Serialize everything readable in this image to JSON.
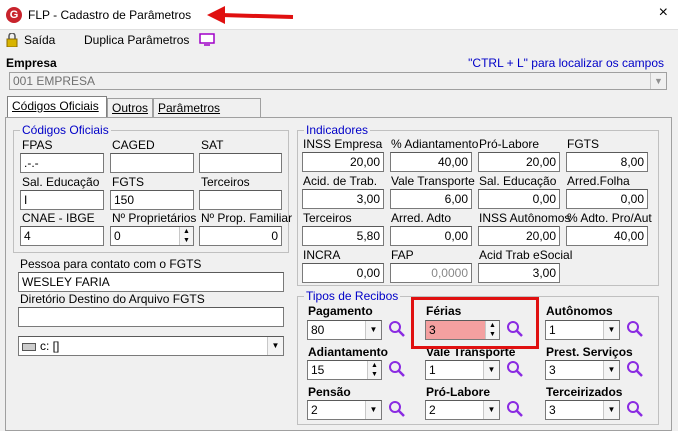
{
  "window": {
    "title": "FLP - Cadastro de Parâmetros",
    "close_symbol": "×",
    "app_icon_letter": "G"
  },
  "toolbar": {
    "exit_label": "Saída",
    "duplicate_label": "Duplica Parâmetros"
  },
  "empresa": {
    "label": "Empresa",
    "hint": "\"CTRL + L\" para localizar os campos",
    "value": "001 EMPRESA"
  },
  "tabs": [
    {
      "label": "Códigos Oficiais",
      "active": true
    },
    {
      "label": "Outros",
      "active": false
    },
    {
      "label": "Parâmetros Internos",
      "active": false
    }
  ],
  "codigos": {
    "legend": "Códigos Oficiais",
    "fpas_label": "FPAS",
    "fpas_value": ".-.-",
    "caged_label": "CAGED",
    "caged_value": "",
    "sat_label": "SAT",
    "sat_value": "",
    "sal_educacao_label": "Sal. Educação",
    "sal_educacao_value": "I",
    "fgts_label": "FGTS",
    "fgts_value": "150",
    "terceiros_label": "Terceiros",
    "terceiros_value": "",
    "cnae_label": "CNAE - IBGE",
    "cnae_value": "4",
    "nproprietarios_label": "Nº Proprietários",
    "nproprietarios_value": "0",
    "npropfamiliar_label": "Nº Prop. Familiar",
    "npropfamiliar_value": "0",
    "contato_label": "Pessoa para contato com o FGTS",
    "contato_value": "WESLEY FARIA",
    "diretorio_label": "Diretório Destino do Arquivo FGTS",
    "diretorio_value": "",
    "drive_value": "c: []"
  },
  "indicadores": {
    "legend": "Indicadores",
    "items": [
      {
        "label": "INSS Empresa",
        "value": "20,00"
      },
      {
        "label": "% Adiantamento",
        "value": "40,00"
      },
      {
        "label": "Pró-Labore",
        "value": "20,00"
      },
      {
        "label": "FGTS",
        "value": "8,00"
      },
      {
        "label": "Acid. de Trab.",
        "value": "3,00"
      },
      {
        "label": "Vale Transporte",
        "value": "6,00"
      },
      {
        "label": "Sal. Educação",
        "value": "0,00"
      },
      {
        "label": "Arred.Folha",
        "value": "0,00"
      },
      {
        "label": "Terceiros",
        "value": "5,80"
      },
      {
        "label": "Arred. Adto",
        "value": "0,00"
      },
      {
        "label": "INSS Autônomos",
        "value": "20,00"
      },
      {
        "label": "% Adto. Pro/Aut",
        "value": "40,00"
      },
      {
        "label": "INCRA",
        "value": "0,00"
      },
      {
        "label": "FAP",
        "value": "0,0000"
      },
      {
        "label": "Acid Trab eSocial",
        "value": "3,00"
      }
    ]
  },
  "recibos": {
    "legend": "Tipos de Recibos",
    "pagamento_label": "Pagamento",
    "pagamento_value": "80",
    "ferias_label": "Férias",
    "ferias_value": "3",
    "autonomos_label": "Autônomos",
    "autonomos_value": "1",
    "adiantamento_label": "Adiantamento",
    "adiantamento_value": "15",
    "vale_transporte_label": "Vale Transporte",
    "vale_transporte_value": "1",
    "prest_servicos_label": "Prest. Serviços",
    "prest_servicos_value": "3",
    "pensao_label": "Pensão",
    "pensao_value": "2",
    "pro_labore_label": "Pró-Labore",
    "pro_labore_value": "2",
    "terceirizados_label": "Terceirizados",
    "terceirizados_value": "3"
  },
  "colors": {
    "accent_blue": "#0000c8",
    "highlight_red": "#e01010",
    "ferias_bg": "#f4a0a0",
    "magnifier": "#8a2be2"
  }
}
